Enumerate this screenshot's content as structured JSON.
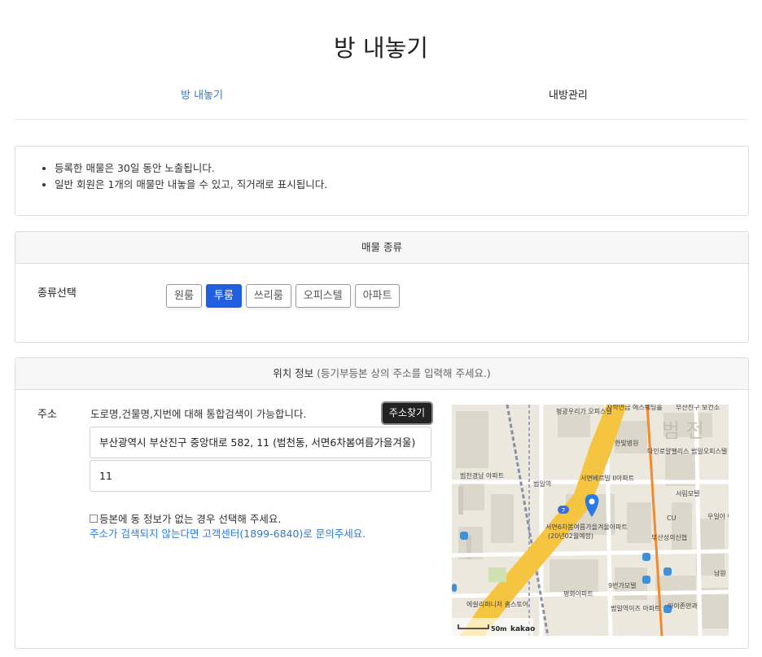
{
  "page": {
    "title": "방 내놓기"
  },
  "tabs": [
    {
      "label": "방 내놓기"
    },
    {
      "label": "내방관리"
    }
  ],
  "notice": {
    "items": [
      "등록한 매물은 30일 동안 노출됩니다.",
      "일반 회원은 1개의 매물만 내놓을 수 있고, 직거래로 표시됩니다."
    ]
  },
  "property_type": {
    "header": "매물 종류",
    "label": "종류선택",
    "options": [
      "원룸",
      "투룸",
      "쓰리룸",
      "오피스텔",
      "아파트"
    ],
    "selected": "투룸"
  },
  "location": {
    "header": "위치 정보",
    "header_sub": "(등기부등본 상의 주소를 입력해 주세요.)",
    "address_label": "주소",
    "hint": "도로명,건물명,지번에 대해 통합검색이 가능합니다.",
    "search_button": "주소찾기",
    "address_value": "부산광역시 부산진구 중앙대로 582, 11 (범천동, 서면6차봄여름가을겨울)",
    "detail_value": "11",
    "no_info_checkbox": "등본에 동 정보가 없는 경우 선택해 주세요.",
    "help_link": "주소가 검색되지 않는다면 고객센터(1899-6840)로 문의주세요."
  },
  "map": {
    "labels": {
      "bank": "사학연금 에스웨딩홀",
      "apt_top": "평광우리가 오피스텔",
      "center_top": "부산진구 보건소",
      "hospital": "한빛병원",
      "danin": "다인로얄팰리스 범일오피스텔",
      "district": "범 전",
      "apt_beomcheon": "범천경남 아파트",
      "station": "범일역",
      "apt_seomyeon": "서면베르빌 II아파트",
      "motel": "서림모텔",
      "cu": "CU",
      "apt_main": "서면6차봄여름가을겨울아파트",
      "apt_main_sub": "(20년02월예정)",
      "church": "부산성의신협",
      "woori": "우일아 아파트",
      "motel9": "9번가모텔",
      "pyeonghwa": "평화아파트",
      "dept": "에쉴리퍼니처 홈스토어",
      "beomilyeok": "범일역이즈 아파트",
      "aijon": "아이존안과",
      "nam": "남원",
      "road_no": "7",
      "scale": "50m",
      "brand": "kakao"
    }
  }
}
